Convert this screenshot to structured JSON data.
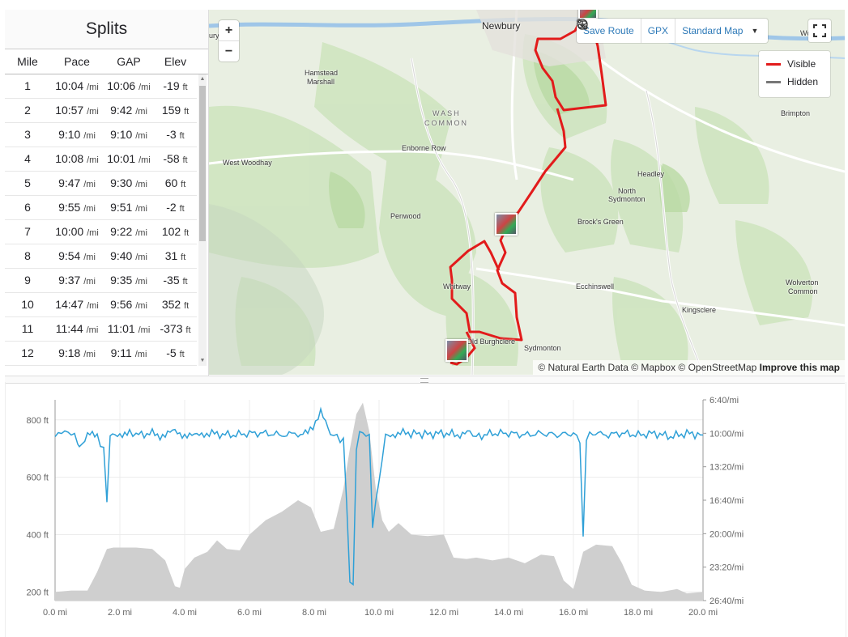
{
  "splits": {
    "title": "Splits",
    "columns": [
      "Mile",
      "Pace",
      "GAP",
      "Elev"
    ],
    "pace_unit": "/mi",
    "elev_unit": "ft",
    "rows": [
      {
        "mile": "1",
        "pace": "10:04",
        "gap": "10:06",
        "elev": "-19"
      },
      {
        "mile": "2",
        "pace": "10:57",
        "gap": "9:42",
        "elev": "159"
      },
      {
        "mile": "3",
        "pace": "9:10",
        "gap": "9:10",
        "elev": "-3"
      },
      {
        "mile": "4",
        "pace": "10:08",
        "gap": "10:01",
        "elev": "-58"
      },
      {
        "mile": "5",
        "pace": "9:47",
        "gap": "9:30",
        "elev": "60"
      },
      {
        "mile": "6",
        "pace": "9:55",
        "gap": "9:51",
        "elev": "-2"
      },
      {
        "mile": "7",
        "pace": "10:00",
        "gap": "9:22",
        "elev": "102"
      },
      {
        "mile": "8",
        "pace": "9:54",
        "gap": "9:40",
        "elev": "31"
      },
      {
        "mile": "9",
        "pace": "9:37",
        "gap": "9:35",
        "elev": "-35"
      },
      {
        "mile": "10",
        "pace": "14:47",
        "gap": "9:56",
        "elev": "352"
      },
      {
        "mile": "11",
        "pace": "11:44",
        "gap": "11:01",
        "elev": "-373"
      },
      {
        "mile": "12",
        "pace": "9:18",
        "gap": "9:11",
        "elev": "-5"
      }
    ]
  },
  "map": {
    "zoom_in": "+",
    "zoom_out": "−",
    "toolbar": {
      "save_route": "Save Route",
      "gpx": "GPX",
      "map_style": "Standard Map"
    },
    "legend": {
      "visible": "Visible",
      "hidden": "Hidden"
    },
    "route_color": "#e21b1b",
    "attribution": {
      "text": "© Natural Earth Data © Mapbox © OpenStreetMap",
      "link": "Improve this map"
    },
    "places": {
      "newbury": "Newbury",
      "hamstead": "Hamstead",
      "marshall": "Marshall",
      "wash": "WASH",
      "common": "COMMON",
      "enborne_row": "Enborne Row",
      "west_woodhay": "West Woodhay",
      "penwood": "Penwood",
      "whitway": "Whitway",
      "old_burghclere": "Old Burghclere",
      "sydmonton": "Sydmonton",
      "north": "North",
      "sydmonton2": "Sydmonton",
      "brocks_green": "Brock's Green",
      "headley": "Headley",
      "ecchinswell": "Ecchinswell",
      "kingsclere": "Kingsclere",
      "brimpton": "Brimpton",
      "wolverton": "Wolverton",
      "common2": "Common",
      "ury": "ury",
      "woolha": "Woolha"
    }
  },
  "chart": {
    "chart_data": {
      "type": "area",
      "x_unit": "mi",
      "x_ticks": [
        "0.0 mi",
        "2.0 mi",
        "4.0 mi",
        "6.0 mi",
        "8.0 mi",
        "10.0 mi",
        "12.0 mi",
        "14.0 mi",
        "16.0 mi",
        "18.0 mi",
        "20.0 mi"
      ],
      "y_left_ticks": [
        "800 ft",
        "600 ft",
        "400 ft",
        "200 ft"
      ],
      "y_right_ticks": [
        "6:40/mi",
        "10:00/mi",
        "13:20/mi",
        "16:40/mi",
        "20:00/mi",
        "23:20/mi",
        "26:40/mi"
      ],
      "xlim": [
        0,
        20
      ],
      "ylim_elev": [
        170,
        870
      ],
      "ylim_pace_sec": [
        400,
        1600
      ],
      "series": [
        {
          "name": "Elevation",
          "color": "#cfcfcf",
          "x": [
            0,
            0.5,
            1.0,
            1.3,
            1.6,
            1.8,
            2.0,
            2.5,
            3.0,
            3.4,
            3.7,
            3.85,
            4.0,
            4.3,
            4.7,
            5.0,
            5.3,
            5.7,
            6.0,
            6.5,
            7.0,
            7.5,
            7.9,
            8.2,
            8.6,
            8.9,
            9.1,
            9.3,
            9.5,
            9.7,
            9.9,
            10.1,
            10.3,
            10.6,
            11.0,
            11.5,
            12.0,
            12.3,
            12.7,
            13.0,
            13.5,
            14.0,
            14.5,
            15.0,
            15.4,
            15.7,
            16.0,
            16.3,
            16.7,
            17.2,
            17.5,
            17.8,
            18.2,
            18.7,
            19.2,
            19.5,
            20.0
          ],
          "values": [
            200,
            205,
            205,
            270,
            350,
            355,
            355,
            355,
            350,
            310,
            220,
            215,
            280,
            320,
            340,
            380,
            350,
            345,
            400,
            450,
            480,
            520,
            495,
            410,
            420,
            560,
            700,
            820,
            860,
            760,
            560,
            450,
            410,
            440,
            400,
            395,
            400,
            320,
            315,
            320,
            310,
            320,
            300,
            330,
            325,
            240,
            210,
            340,
            365,
            360,
            300,
            225,
            205,
            200,
            210,
            195,
            200
          ]
        },
        {
          "name": "Pace",
          "color": "#2fa0d7",
          "note": "seconds per mile",
          "x": [
            0,
            0.1,
            0.3,
            0.5,
            0.7,
            0.75,
            1.0,
            1.3,
            1.5,
            1.6,
            1.7,
            2.0,
            2.3,
            2.5,
            3.0,
            3.4,
            3.7,
            4.0,
            4.3,
            4.6,
            5.0,
            5.5,
            6.0,
            6.5,
            7.0,
            7.3,
            7.5,
            7.8,
            8.2,
            8.5,
            8.7,
            8.9,
            9.0,
            9.1,
            9.2,
            9.3,
            9.4,
            9.5,
            9.7,
            9.8,
            10.0,
            10.2,
            10.5,
            10.9,
            11.5,
            12.0,
            12.5,
            12.8,
            13.0,
            13.5,
            14.0,
            14.5,
            15.0,
            15.5,
            16.0,
            16.2,
            16.3,
            16.4,
            16.6,
            17.0,
            17.5,
            18.0,
            18.5,
            19.0,
            19.5,
            20.0
          ],
          "values": [
            620,
            600,
            590,
            600,
            640,
            680,
            610,
            620,
            700,
            1000,
            620,
            600,
            595,
            610,
            600,
            620,
            580,
            610,
            620,
            600,
            605,
            610,
            600,
            600,
            610,
            590,
            620,
            600,
            480,
            600,
            620,
            650,
            1000,
            1500,
            1500,
            700,
            590,
            600,
            620,
            1150,
            880,
            620,
            600,
            600,
            605,
            600,
            610,
            600,
            620,
            600,
            600,
            610,
            600,
            610,
            600,
            640,
            1240,
            620,
            600,
            610,
            600,
            610,
            600,
            620,
            600,
            610
          ]
        }
      ]
    }
  }
}
